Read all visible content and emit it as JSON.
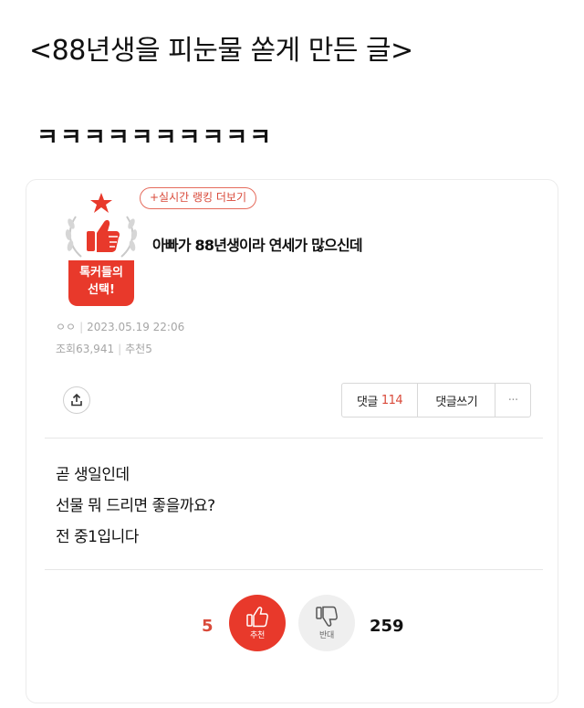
{
  "post": {
    "title": "<88년생을 피눈물 쏟게 만든 글>",
    "subtitle": "ㅋㅋㅋㅋㅋㅋㅋㅋㅋㅋ"
  },
  "card": {
    "badge_line1": "톡커들의",
    "badge_line2": "선택!",
    "ranking_link": "+실시간 랭킹 더보기",
    "article_title": "아빠가 88년생이라 연세가 많으신데",
    "author": "ㅇㅇ",
    "date": "2023.05.19 22:06",
    "views_label": "조회",
    "views": "63,941",
    "recommend_label": "추천",
    "recommend": "5",
    "comments_label": "댓글",
    "comments_count": "114",
    "write_comment": "댓글쓰기",
    "more": "···",
    "body_lines": [
      "곧 생일인데",
      "선물 뭐 드리면 좋을까요?",
      "전 중1입니다"
    ],
    "vote_up_label": "추천",
    "vote_up_count": "5",
    "vote_down_label": "반대",
    "vote_down_count": "259"
  },
  "colors": {
    "accent": "#e8392b",
    "accent_text": "#d94a3a",
    "muted": "#a6a6a6"
  },
  "icons": [
    "star-icon",
    "thumbs-up-icon",
    "laurel-icon",
    "share-icon",
    "thumbs-down-icon"
  ]
}
